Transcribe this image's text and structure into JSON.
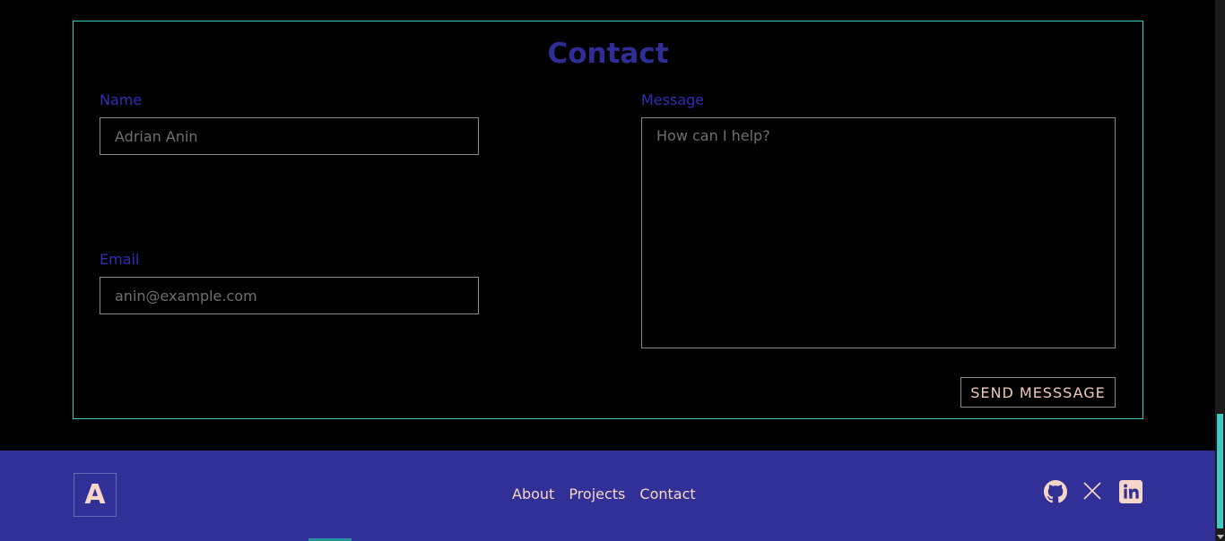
{
  "contact": {
    "title": "Contact",
    "name_label": "Name",
    "name_placeholder": "Adrian Anin",
    "email_label": "Email",
    "email_placeholder": "anin@example.com",
    "message_label": "Message",
    "message_placeholder": "How can I help?",
    "send_label": "SEND MESSSAGE"
  },
  "footer": {
    "logo": "A",
    "nav": [
      "About",
      "Projects",
      "Contact"
    ],
    "social_icons": [
      "github-icon",
      "x-icon",
      "linkedin-icon"
    ]
  },
  "colors": {
    "background": "#000000",
    "accent": "#3fc9c4",
    "title": "#2e2e96",
    "footer_bg": "#303096",
    "footer_text": "#f6d6c8"
  }
}
